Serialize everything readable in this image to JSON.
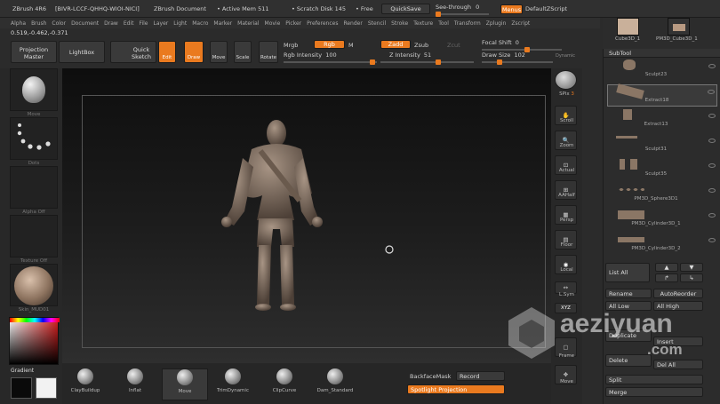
{
  "titlebar": {
    "app": "ZBrush 4R6",
    "serial": "[BIVR-LCCF-QHHQ-WIOI-NICI]",
    "doc": "ZBrush Document",
    "active_mem": "• Active Mem 511",
    "scratch": "• Scratch Disk 145",
    "free": "• Free",
    "quicksave": "QuickSave",
    "see_through": "See-through",
    "see_through_val": "0",
    "menus": "Menus",
    "script": "DefaultZScript"
  },
  "menubar": [
    "Alpha",
    "Brush",
    "Color",
    "Document",
    "Draw",
    "Edit",
    "File",
    "Layer",
    "Light",
    "Macro",
    "Marker",
    "Material",
    "Movie",
    "Picker",
    "Preferences",
    "Render",
    "Stencil",
    "Stroke",
    "Texture",
    "Tool",
    "Transform",
    "Zplugin",
    "Zscript"
  ],
  "coords": "0.519,-0.462,-0.371",
  "toolbar": {
    "projection_master": "Projection Master",
    "lightbox": "LightBox",
    "quick_sketch": "Quick Sketch",
    "edit": "Edit",
    "draw": "Draw",
    "move": "Move",
    "scale": "Scale",
    "rotate": "Rotate",
    "mrgb": "Mrgb",
    "rgb": "Rgb",
    "m": "M",
    "rgb_intensity": "Rgb Intensity",
    "rgb_intensity_val": "100",
    "zadd": "Zadd",
    "zsub": "Zsub",
    "zcut": "Zcut",
    "z_intensity": "Z Intensity",
    "z_intensity_val": "51",
    "focal_shift": "Focal Shift",
    "focal_shift_val": "0",
    "draw_size": "Draw Size",
    "draw_size_val": "102",
    "dynamic": "Dynamic"
  },
  "leftshelf": {
    "brush": "Move",
    "stroke": "Dots",
    "alpha": "Alpha Off",
    "texture": "Texture Off",
    "material": "Skin_MUD01",
    "gradient": "Gradient",
    "colors": {
      "main": "#0a0a0a",
      "secondary": "#f2f2f2"
    }
  },
  "rightshelf": {
    "spix": "SPix",
    "spix_val": "3",
    "scroll": "Scroll",
    "zoom": "Zoom",
    "actual": "Actual",
    "aahalf": "AAHalf",
    "persp": "Persp",
    "floor": "Floor",
    "local": "Local",
    "lsym": "L.Sym",
    "xyz": "XYZ",
    "frame": "Frame",
    "move": "Move"
  },
  "toolthumbs": [
    "Cube3D_1",
    "PM3D_Cube3D_1"
  ],
  "subtool": {
    "header": "SubTool",
    "items": [
      "Sculpt23",
      "Extract18",
      "Extract13",
      "Sculpt31",
      "Sculpt35",
      "PM3D_Sphere3D1",
      "PM3D_Cylinder3D_1",
      "PM3D_Cylinder3D_2"
    ],
    "list_all": "List All",
    "rename": "Rename",
    "autoreorder": "AutoReorder",
    "all_low": "All Low",
    "all_high": "All High",
    "duplicate": "Duplicate",
    "insert": "Insert",
    "delete": "Delete",
    "del_all": "Del All",
    "split": "Split",
    "merge": "Merge"
  },
  "bottombar": {
    "brushes": [
      "ClayBuildup",
      "Inflat",
      "Move",
      "TrimDynamic",
      "ClipCurve",
      "Dam_Standard"
    ],
    "backfacemask": "BackfaceMask",
    "record": "Record",
    "spotlight": "Spotlight Projection"
  },
  "watermark": {
    "name": "aeziyuan",
    "domain": ".com"
  },
  "colors": {
    "accent": "#ea7a1f"
  }
}
